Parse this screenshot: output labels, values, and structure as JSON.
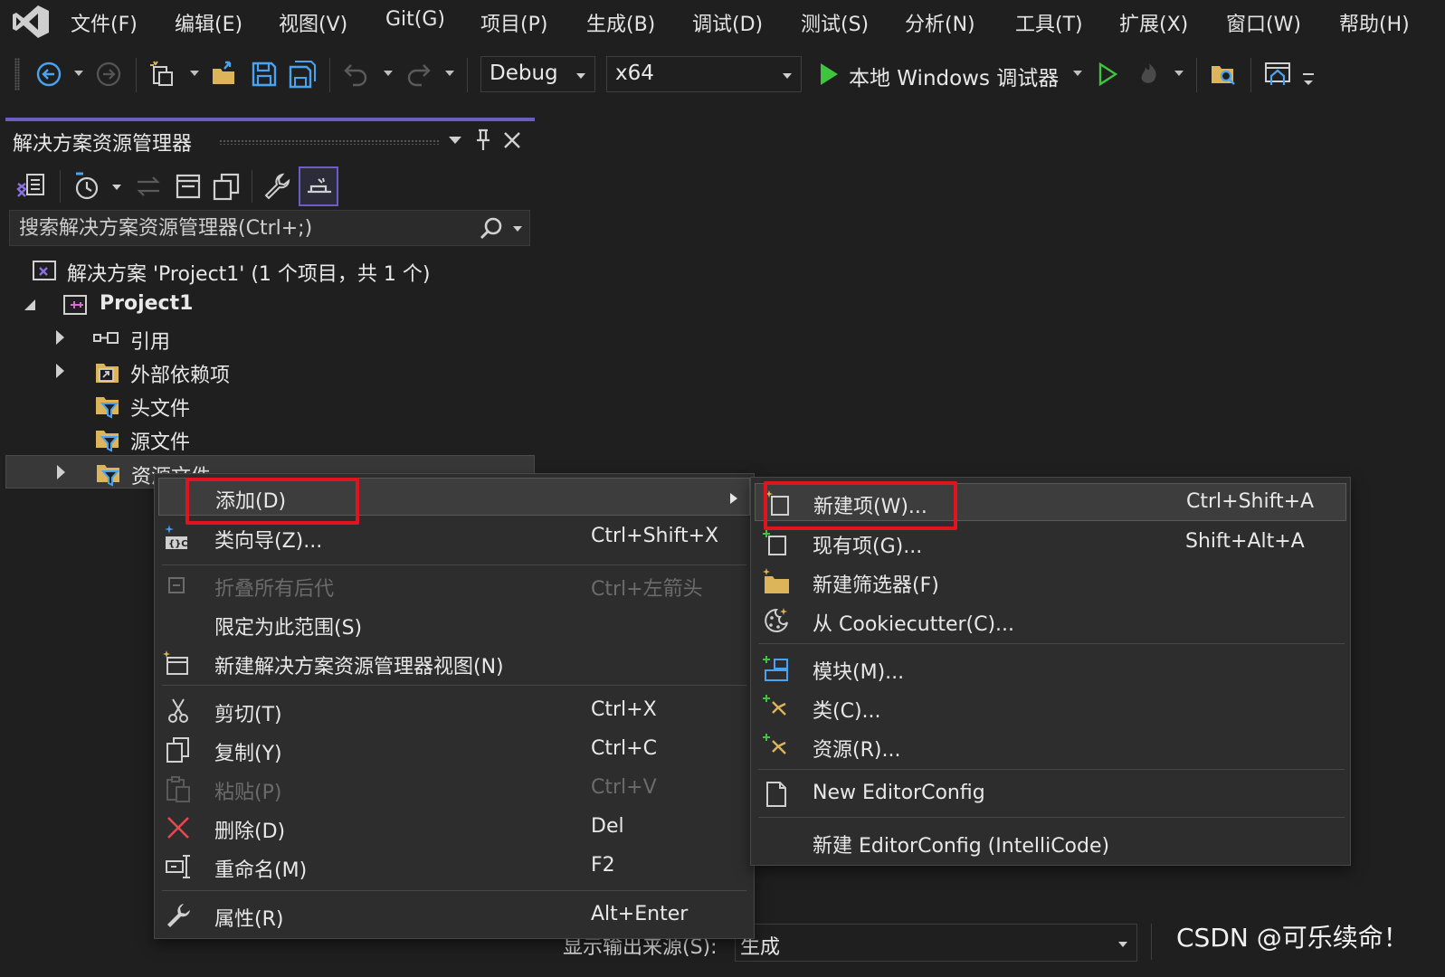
{
  "menubar": {
    "items": [
      "文件(F)",
      "编辑(E)",
      "视图(V)",
      "Git(G)",
      "项目(P)",
      "生成(B)",
      "调试(D)",
      "测试(S)",
      "分析(N)",
      "工具(T)",
      "扩展(X)",
      "窗口(W)",
      "帮助(H)"
    ]
  },
  "toolbar": {
    "config": "Debug",
    "platform": "x64",
    "run_target": "本地 Windows 调试器"
  },
  "solution_explorer": {
    "title": "解决方案资源管理器",
    "search_placeholder": "搜索解决方案资源管理器(Ctrl+;)",
    "tree": {
      "solution": "解决方案 'Project1' (1 个项目，共 1 个)",
      "project": "Project1",
      "references": "引用",
      "external_deps": "外部依赖项",
      "header_files": "头文件",
      "source_files": "源文件",
      "resource_files": "资源文件"
    }
  },
  "context_menu": {
    "add": "添加(D)",
    "class_wizard": "类向导(Z)...",
    "class_wizard_shortcut": "Ctrl+Shift+X",
    "collapse_all": "折叠所有后代",
    "collapse_all_shortcut": "Ctrl+左箭头",
    "scope_to_this": "限定为此范围(S)",
    "new_se_view": "新建解决方案资源管理器视图(N)",
    "cut": "剪切(T)",
    "cut_shortcut": "Ctrl+X",
    "copy": "复制(Y)",
    "copy_shortcut": "Ctrl+C",
    "paste": "粘贴(P)",
    "paste_shortcut": "Ctrl+V",
    "delete": "删除(D)",
    "delete_shortcut": "Del",
    "rename": "重命名(M)",
    "rename_shortcut": "F2",
    "properties": "属性(R)",
    "properties_shortcut": "Alt+Enter"
  },
  "submenu": {
    "new_item": "新建项(W)...",
    "new_item_shortcut": "Ctrl+Shift+A",
    "existing_item": "现有项(G)...",
    "existing_item_shortcut": "Shift+Alt+A",
    "new_filter": "新建筛选器(F)",
    "from_cookiecutter": "从 Cookiecutter(C)...",
    "module": "模块(M)...",
    "class": "类(C)...",
    "resource": "资源(R)...",
    "new_editorconfig": "New EditorConfig",
    "new_editorconfig_intellicode": "新建 EditorConfig (IntelliCode)"
  },
  "output": {
    "source_label": "显示输出来源(S):",
    "source_value": "生成"
  },
  "watermark": "CSDN @可乐续命！",
  "colors": {
    "accent": "#6a5fc1",
    "highlight_border": "#e0141e",
    "run_green": "#3ec43e",
    "folder_yellow": "#dcb45a",
    "icon_blue": "#4aa3f0"
  }
}
